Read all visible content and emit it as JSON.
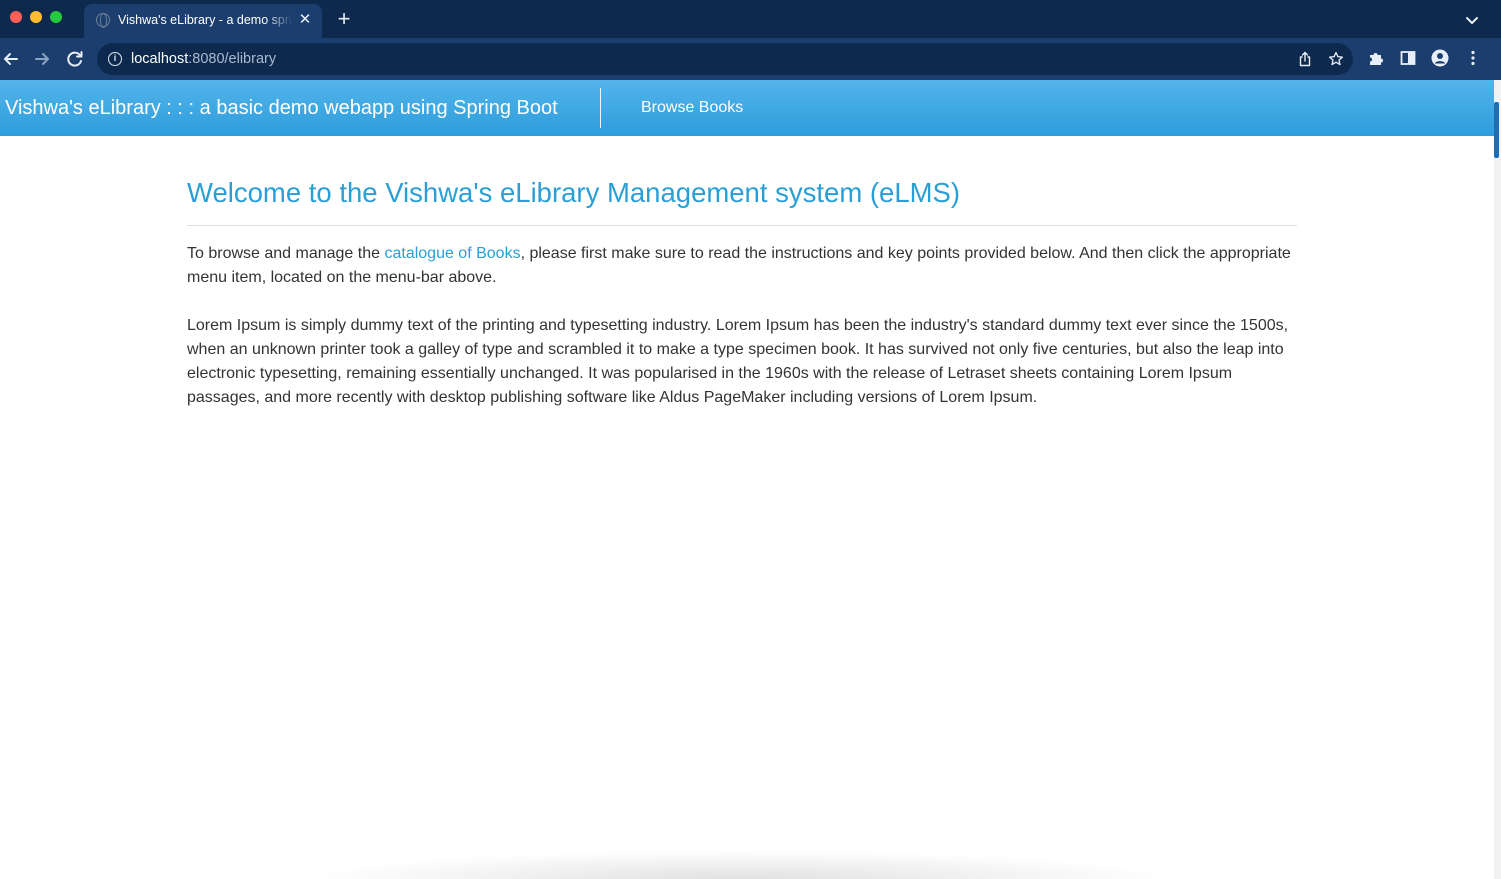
{
  "browser": {
    "tab": {
      "title": "Vishwa's eLibrary - a demo spring boot webapp",
      "close_glyph": "✕"
    },
    "new_tab_glyph": "+",
    "url": {
      "host": "localhost",
      "path": ":8080/elibrary"
    },
    "icons": [
      "globe-icon",
      "close-icon",
      "plus-icon",
      "chevron-down-icon",
      "back-arrow-icon",
      "forward-arrow-icon",
      "reload-icon",
      "info-icon",
      "share-icon",
      "star-icon",
      "puzzle-icon",
      "side-panel-icon",
      "profile-icon",
      "kebab-menu-icon"
    ]
  },
  "app": {
    "brand": "Vishwa's eLibrary : : : a basic demo webapp using Spring Boot",
    "nav_link": "Browse Books",
    "colors": {
      "accent": "#2a9fd6",
      "nav_bg_top": "#54b4ea",
      "nav_bg_bottom": "#2c9ddc",
      "text": "#333333"
    }
  },
  "main": {
    "title": "Welcome to the Vishwa's eLibrary Management system (eLMS)",
    "intro": {
      "before_link": "To browse and manage the ",
      "link_text": "catalogue of Books",
      "after_link": ", please first make sure to read the instructions and key points provided below. And then click the appropriate menu item, located on the menu-bar above."
    },
    "lorem": "Lorem Ipsum is simply dummy text of the printing and typesetting industry. Lorem Ipsum has been the industry's standard dummy text ever since the 1500s, when an unknown printer took a galley of type and scrambled it to make a type specimen book. It has survived not only five centuries, but also the leap into electronic typesetting, remaining essentially unchanged. It was popularised in the 1960s with the release of Letraset sheets containing Lorem Ipsum passages, and more recently with desktop publishing software like Aldus PageMaker including versions of Lorem Ipsum."
  }
}
